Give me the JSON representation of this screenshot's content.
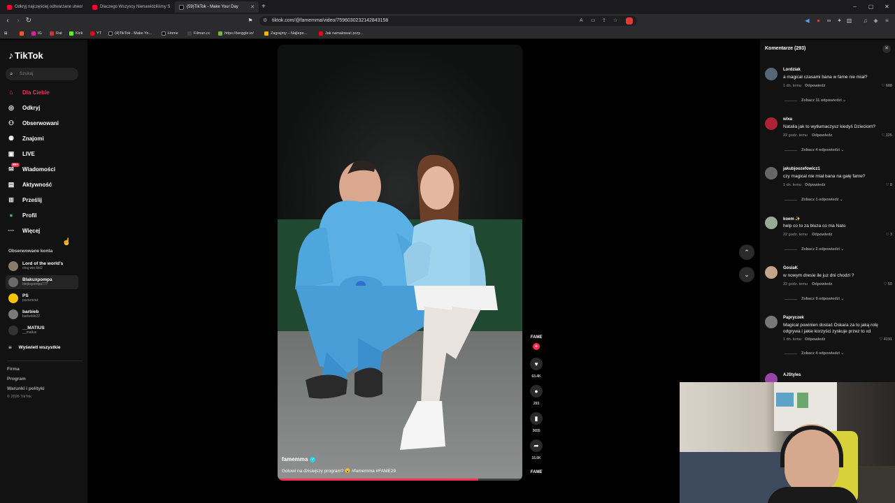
{
  "browser": {
    "tabs": [
      {
        "title": "Odkryj najczęściej odtwarzane utwor",
        "fav_color": "#ff0033"
      },
      {
        "title": "Dlaczego Wszyscy Nienawidziliśmy S",
        "fav_color": "#ff0033"
      },
      {
        "title": "(59)TikTok - Make Your Day",
        "fav_color": "#000000",
        "active": true
      }
    ],
    "new_tab": "+",
    "url": "tiktok.com/@famemma/video/7596030232142843158",
    "window_controls": [
      "–",
      "▢",
      "✕"
    ],
    "bookmarks": [
      {
        "label": "",
        "color": "#ff5722"
      },
      {
        "label": "IG",
        "color": "#d6249f"
      },
      {
        "label": "Rat",
        "color": "#cc3333"
      },
      {
        "label": "Kick",
        "color": "#53fc18"
      },
      {
        "label": "YT",
        "color": "#ff0000"
      },
      {
        "label": "(4)TikTok - Make Yo...",
        "color": "#000000"
      },
      {
        "label": "Home",
        "color": "#000000"
      },
      {
        "label": "Filman.cc",
        "color": "#444444"
      },
      {
        "label": "https://tanggle.io/",
        "color": "#7cb342"
      },
      {
        "label": "Zagrajmy – Najleps...",
        "color": "#f4b400"
      },
      {
        "label": "Jak namalować przy...",
        "color": "#ff0000"
      }
    ]
  },
  "sidebar": {
    "logo": "TikTok",
    "search_placeholder": "Szukaj",
    "nav": [
      {
        "label": "Dla Ciebie",
        "icon": "home-icon",
        "glyph": "⌂",
        "active": true
      },
      {
        "label": "Odkryj",
        "icon": "compass-icon",
        "glyph": "◎"
      },
      {
        "label": "Obserwowani",
        "icon": "following-icon",
        "glyph": "⚇"
      },
      {
        "label": "Znajomi",
        "icon": "friends-icon",
        "glyph": "⚉"
      },
      {
        "label": "LIVE",
        "icon": "live-icon",
        "glyph": "▣"
      },
      {
        "label": "Wiadomości",
        "icon": "messages-icon",
        "glyph": "✉",
        "badge": "99+"
      },
      {
        "label": "Aktywność",
        "icon": "activity-icon",
        "glyph": "▤"
      },
      {
        "label": "Prześlij",
        "icon": "upload-icon",
        "glyph": "⊞"
      },
      {
        "label": "Profil",
        "icon": "profile-icon",
        "glyph": "●"
      },
      {
        "label": "Więcej",
        "icon": "more-icon",
        "glyph": "···"
      }
    ],
    "followed_title": "Obserwowane konta",
    "accounts": [
      {
        "name": "Lord of the world's",
        "handle": "chuj.wie.kto2",
        "color": "#8a7a6a"
      },
      {
        "name": "Blakuxpompa",
        "handle": "blejkspompa777",
        "color": "#6a6a6a"
      },
      {
        "name": "PS",
        "handle": "pszszszsz",
        "color": "#f4c20d"
      },
      {
        "name": "barbieb",
        "handle": "barbeble22",
        "color": "#7a7a7a"
      },
      {
        "name": "__MATIUS",
        "handle": "__matius",
        "color": "#333333"
      }
    ],
    "show_all": "Wyświetl wszystkie",
    "footer": [
      "Firma",
      "Program",
      "Warunki i polityki"
    ],
    "copyright": "© 2026 TikTok"
  },
  "video": {
    "author": "famemma",
    "caption": "Gotowi na dzisiejszy program? 😮 #famemma #FAME29",
    "progress": 0.82
  },
  "actions": {
    "fame_top": "FAME",
    "fame_bottom": "FAME",
    "likes": "63.4K",
    "comments": "293",
    "saves": "3655",
    "shares": "15.6K"
  },
  "comments_panel": {
    "title": "Komentarze (293)",
    "reply_label": "Odpowiedz",
    "comments": [
      {
        "user": "Lordziak",
        "text": "a magical czasami bana w fame nie miał?",
        "time": "1 dn. temu",
        "likes": "688",
        "view": "Zobacz 11 odpowiedzi",
        "color": "#556677"
      },
      {
        "user": "wixa",
        "text": "Natalia jak to wytłumaczysz kiedyś Dzieciom?",
        "time": "22 godz. temu",
        "likes": "125",
        "view": "Zobacz 4 odpowiedzi",
        "color": "#aa2233"
      },
      {
        "user": "jakubjoozefowicz1",
        "text": "czy magical nie miał bana na gałę fame?",
        "time": "1 dn. temu",
        "likes": "8",
        "view": "Zobacz 1 odpowiedź",
        "color": "#666666"
      },
      {
        "user": "koem ✨",
        "text": "help co to za bluza co ma Nato",
        "time": "22 godz. temu",
        "likes": "3",
        "view": "Zobacz 2 odpowiedzi",
        "color": "#99aa99"
      },
      {
        "user": "GosiaK",
        "text": "w nowym dresie ile juz dni chodzi ?",
        "time": "22 godz. temu",
        "likes": "50",
        "view": "Zobacz 9 odpowiedzi",
        "color": "#c4a58a"
      },
      {
        "user": "Papryczek",
        "text": "Magical powinien dostać Oskara za to jaką rolę odgrywa i jakie korzyści zyskuje przez to xd",
        "time": "1 dn. temu",
        "likes": "4191",
        "view": "Zobacz 4 odpowiedzi",
        "color": "#777777"
      },
      {
        "user": "AJStyles",
        "text": "",
        "time": "",
        "likes": "",
        "view": "",
        "color": "#9944aa"
      }
    ]
  }
}
